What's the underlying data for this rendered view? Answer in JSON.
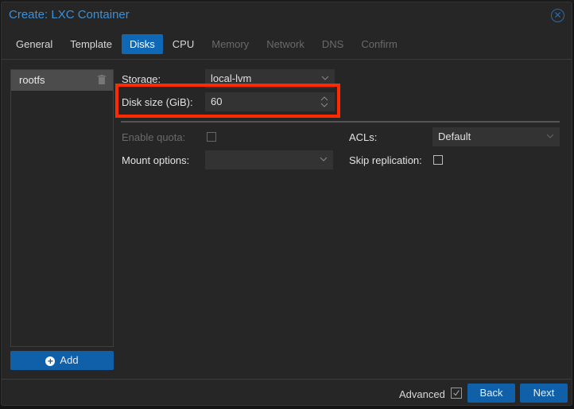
{
  "window": {
    "title": "Create: LXC Container",
    "close_icon": "close-circle-icon"
  },
  "tabs": [
    {
      "label": "General",
      "state": "enabled"
    },
    {
      "label": "Template",
      "state": "enabled"
    },
    {
      "label": "Disks",
      "state": "active"
    },
    {
      "label": "CPU",
      "state": "enabled"
    },
    {
      "label": "Memory",
      "state": "disabled"
    },
    {
      "label": "Network",
      "state": "disabled"
    },
    {
      "label": "DNS",
      "state": "disabled"
    },
    {
      "label": "Confirm",
      "state": "disabled"
    }
  ],
  "disk_list": {
    "items": [
      {
        "label": "rootfs",
        "icon": "trash-icon"
      }
    ],
    "add_label": "Add",
    "add_icon": "plus-circle-icon"
  },
  "form": {
    "storage": {
      "label": "Storage:",
      "value": "local-lvm"
    },
    "disk_size": {
      "label": "Disk size (GiB):",
      "value": "60"
    },
    "enable_quota": {
      "label": "Enable quota:",
      "checked": false,
      "disabled": true
    },
    "mount_options": {
      "label": "Mount options:",
      "value": ""
    },
    "acls": {
      "label": "ACLs:",
      "value": "Default"
    },
    "skip_replication": {
      "label": "Skip replication:",
      "checked": false
    }
  },
  "highlight": {
    "target": "disk-size-field",
    "color": "#ff2a00"
  },
  "footer": {
    "advanced_label": "Advanced",
    "advanced_checked": true,
    "back_label": "Back",
    "next_label": "Next"
  },
  "colors": {
    "accent": "#0f60a8",
    "title": "#3c90d6",
    "background": "#262626"
  }
}
